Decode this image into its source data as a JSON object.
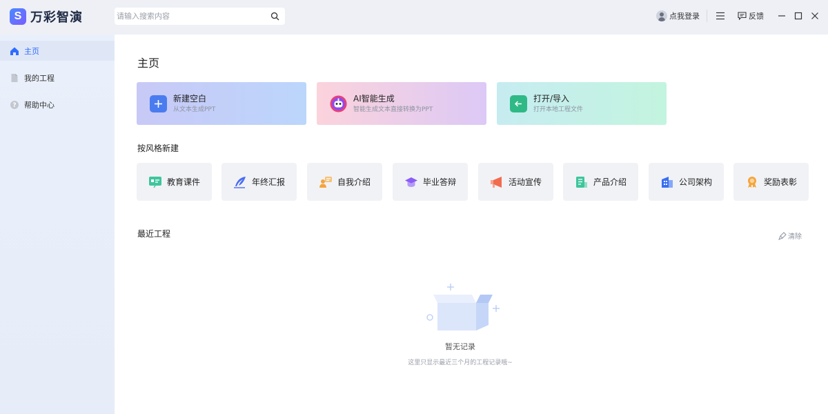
{
  "app": {
    "name": "万彩智演"
  },
  "search": {
    "placeholder": "请输入搜索内容"
  },
  "header": {
    "login_label": "点我登录",
    "feedback_label": "反馈"
  },
  "sidebar": {
    "items": [
      {
        "label": "主页",
        "icon": "home-icon",
        "active": true
      },
      {
        "label": "我的工程",
        "icon": "file-icon",
        "active": false
      },
      {
        "label": "帮助中心",
        "icon": "help-icon",
        "active": false
      }
    ]
  },
  "main": {
    "title": "主页",
    "cards": [
      {
        "title": "新建空白",
        "subtitle": "从文本生成PPT",
        "icon": "plus-icon",
        "color": "#4a7cf0"
      },
      {
        "title": "AI智能生成",
        "subtitle": "智能生成文本直接转换为PPT",
        "icon": "robot-icon",
        "color": "#e8407a"
      },
      {
        "title": "打开/导入",
        "subtitle": "打开本地工程文件",
        "icon": "import-icon",
        "color": "#2fb987"
      }
    ],
    "style_section_title": "按风格新建",
    "styles": [
      {
        "label": "教育课件",
        "icon": "courseware-icon",
        "color": "#3ec59b"
      },
      {
        "label": "年终汇报",
        "icon": "feather-icon",
        "color": "#4a6df0"
      },
      {
        "label": "自我介绍",
        "icon": "person-card-icon",
        "color": "#f5a43c"
      },
      {
        "label": "毕业答辩",
        "icon": "graduation-cap-icon",
        "color": "#8b5cf6"
      },
      {
        "label": "活动宣传",
        "icon": "megaphone-icon",
        "color": "#f26b4f"
      },
      {
        "label": "产品介绍",
        "icon": "document-icon",
        "color": "#3ec59b"
      },
      {
        "label": "公司架构",
        "icon": "building-icon",
        "color": "#3a6ff0"
      },
      {
        "label": "奖励表彰",
        "icon": "medal-icon",
        "color": "#f5a43c"
      }
    ],
    "recent_title": "最近工程",
    "clear_label": "清除",
    "empty_title": "暂无记录",
    "empty_subtitle": "这里只显示最近三个月的工程记录哦~"
  }
}
